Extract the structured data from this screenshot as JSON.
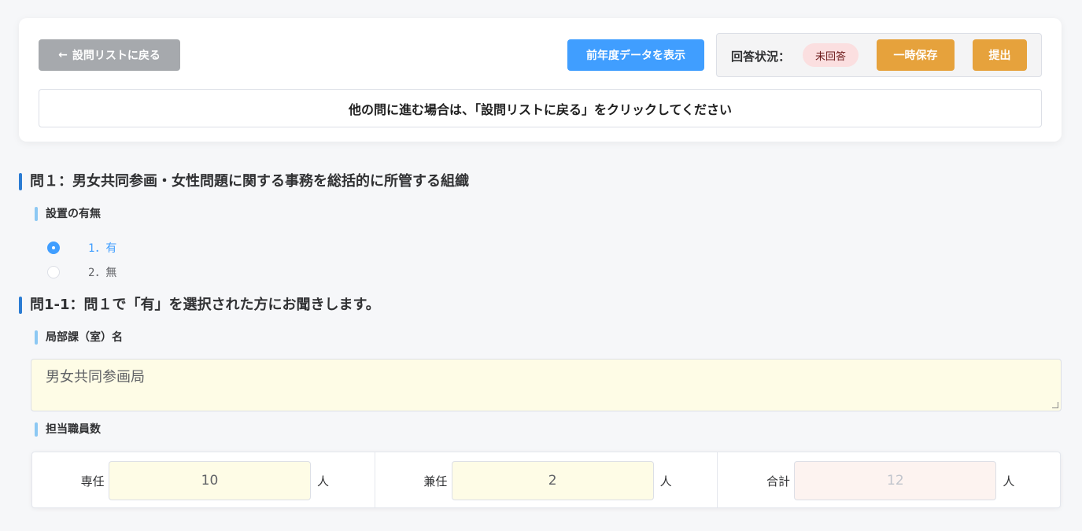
{
  "header": {
    "back_label": "設問リストに戻る",
    "back_icon": "arrow-left-icon",
    "prev_year_label": "前年度データを表示",
    "status_label": "回答状況：",
    "status_value": "未回答",
    "save_label": "一時保存",
    "submit_label": "提出",
    "notice": "他の問に進む場合は、「設問リストに戻る」をクリックしてください"
  },
  "q1": {
    "title": "問１：男女共同参画・女性問題に関する事務を総括的に所管する組織",
    "sub_title": "設置の有無",
    "options": [
      {
        "label": "1．有",
        "selected": true
      },
      {
        "label": "2．無",
        "selected": false
      }
    ]
  },
  "q1_1": {
    "title": "問1-1：問１で「有」を選択された方にお聞きします。",
    "dept_label": "局部課（室）名",
    "dept_value": "男女共同参画局",
    "staff_label": "担当職員数",
    "staff": [
      {
        "label": "専任",
        "value": "10",
        "unit": "人"
      },
      {
        "label": "兼任",
        "value": "2",
        "unit": "人"
      },
      {
        "label": "合計",
        "value": "12",
        "unit": "人"
      }
    ]
  },
  "colors": {
    "primary": "#409eff",
    "warning": "#e6a23c",
    "info": "#a6a9ad",
    "input_bg": "#fefce6"
  }
}
